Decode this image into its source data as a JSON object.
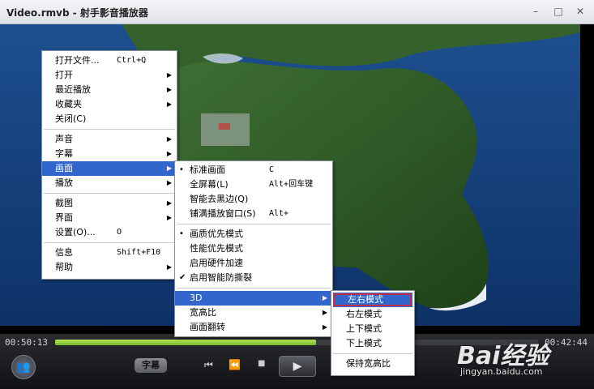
{
  "window": {
    "title": "Video.rmvb - 射手影音播放器",
    "min_glyph": "–",
    "max_glyph": "□",
    "close_glyph": "✕"
  },
  "player": {
    "time_elapsed": "00:50:13",
    "time_total": "00:42:44",
    "progress": 0.54,
    "subtitle_label": "字幕",
    "prev_glyph": "⏮",
    "rewind_glyph": "⏪",
    "stop_glyph": "■",
    "play_glyph": "▶",
    "avatar_glyph": "👥"
  },
  "main_menu": {
    "items": [
      {
        "label": "打开文件...",
        "shortcut": "Ctrl+Q",
        "arrow": ""
      },
      {
        "label": "打开",
        "shortcut": "",
        "arrow": "▶"
      },
      {
        "label": "最近播放",
        "shortcut": "",
        "arrow": "▶"
      },
      {
        "label": "收藏夹",
        "shortcut": "",
        "arrow": "▶"
      },
      {
        "label": "关闭(C)",
        "shortcut": "",
        "arrow": ""
      },
      {
        "label": "声音",
        "shortcut": "",
        "arrow": "▶"
      },
      {
        "label": "字幕",
        "shortcut": "",
        "arrow": "▶"
      },
      {
        "label": "画面",
        "shortcut": "",
        "arrow": "▶"
      },
      {
        "label": "播放",
        "shortcut": "",
        "arrow": "▶"
      },
      {
        "label": "截图",
        "shortcut": "",
        "arrow": "▶"
      },
      {
        "label": "界面",
        "shortcut": "",
        "arrow": "▶"
      },
      {
        "label": "设置(O)...",
        "shortcut": "O",
        "arrow": ""
      },
      {
        "label": "信息",
        "shortcut": "Shift+F10",
        "arrow": ""
      },
      {
        "label": "帮助",
        "shortcut": "",
        "arrow": "▶"
      }
    ]
  },
  "picture_menu": {
    "items": [
      {
        "mark": "•",
        "label": "标准画面",
        "shortcut": "C",
        "arrow": ""
      },
      {
        "mark": "",
        "label": "全屏幕(L)",
        "shortcut": "Alt+回车键",
        "arrow": ""
      },
      {
        "mark": "",
        "label": "智能去黑边(Q)",
        "shortcut": "",
        "arrow": ""
      },
      {
        "mark": "",
        "label": "铺满播放窗口(S)",
        "shortcut": "Alt+",
        "arrow": ""
      },
      {
        "mark": "•",
        "label": "画质优先模式",
        "shortcut": "",
        "arrow": ""
      },
      {
        "mark": "",
        "label": "性能优先模式",
        "shortcut": "",
        "arrow": ""
      },
      {
        "mark": "",
        "label": "启用硬件加速",
        "shortcut": "",
        "arrow": ""
      },
      {
        "mark": "✔",
        "label": "启用智能防撕裂",
        "shortcut": "",
        "arrow": ""
      },
      {
        "mark": "",
        "label": "3D",
        "shortcut": "",
        "arrow": "▶"
      },
      {
        "mark": "",
        "label": "宽高比",
        "shortcut": "",
        "arrow": "▶"
      },
      {
        "mark": "",
        "label": "画面翻转",
        "shortcut": "",
        "arrow": "▶"
      }
    ]
  },
  "threed_menu": {
    "items": [
      {
        "label": "左右模式"
      },
      {
        "label": "右左模式"
      },
      {
        "label": "上下模式"
      },
      {
        "label": "下上模式"
      },
      {
        "label": "保持宽高比"
      }
    ]
  },
  "watermark": {
    "brand": "Bai经验",
    "url": "jingyan.baidu.com"
  },
  "colors": {
    "menu_highlight": "#3366cc",
    "callout_border": "#c0304a",
    "progress_fill": "#8cc63f"
  }
}
